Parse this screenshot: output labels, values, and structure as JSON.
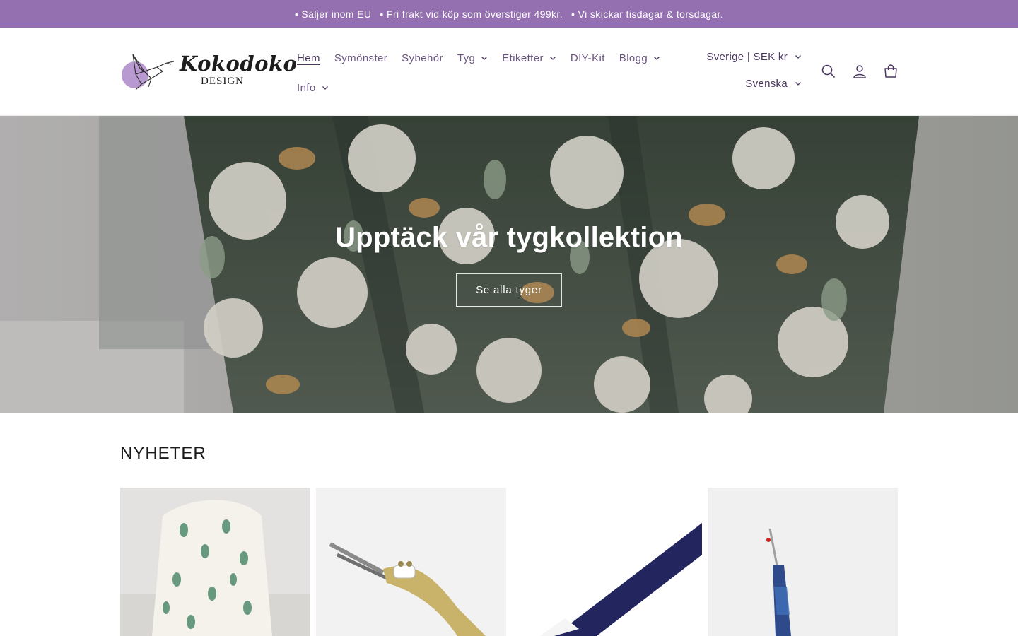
{
  "announcement": {
    "items": [
      "• Säljer inom EU",
      "• Fri frakt vid köp som överstiger 499kr.",
      "• Vi skickar tisdagar & torsdagar."
    ]
  },
  "logo": {
    "title": "Kokodoko",
    "subtitle": "DESIGN"
  },
  "nav": {
    "items": [
      {
        "label": "Hem",
        "active": true,
        "dropdown": false
      },
      {
        "label": "Symönster",
        "active": false,
        "dropdown": false
      },
      {
        "label": "Sybehör",
        "active": false,
        "dropdown": false
      },
      {
        "label": "Tyg",
        "active": false,
        "dropdown": true
      },
      {
        "label": "Etiketter",
        "active": false,
        "dropdown": true
      },
      {
        "label": "DIY-Kit",
        "active": false,
        "dropdown": false
      },
      {
        "label": "Blogg",
        "active": false,
        "dropdown": true
      },
      {
        "label": "Info",
        "active": false,
        "dropdown": true
      }
    ]
  },
  "locale": {
    "country": "Sverige | SEK kr",
    "language": "Svenska"
  },
  "icons": {
    "search": "search-icon",
    "account": "account-icon",
    "cart": "cart-icon"
  },
  "hero": {
    "title": "Upptäck vår tygkollektion",
    "button": "Se alla tyger"
  },
  "products": {
    "title": "NYHETER"
  },
  "colors": {
    "announcement_bg": "#9570b0",
    "nav_text": "#6a5480",
    "accent": "#b89ad0"
  }
}
